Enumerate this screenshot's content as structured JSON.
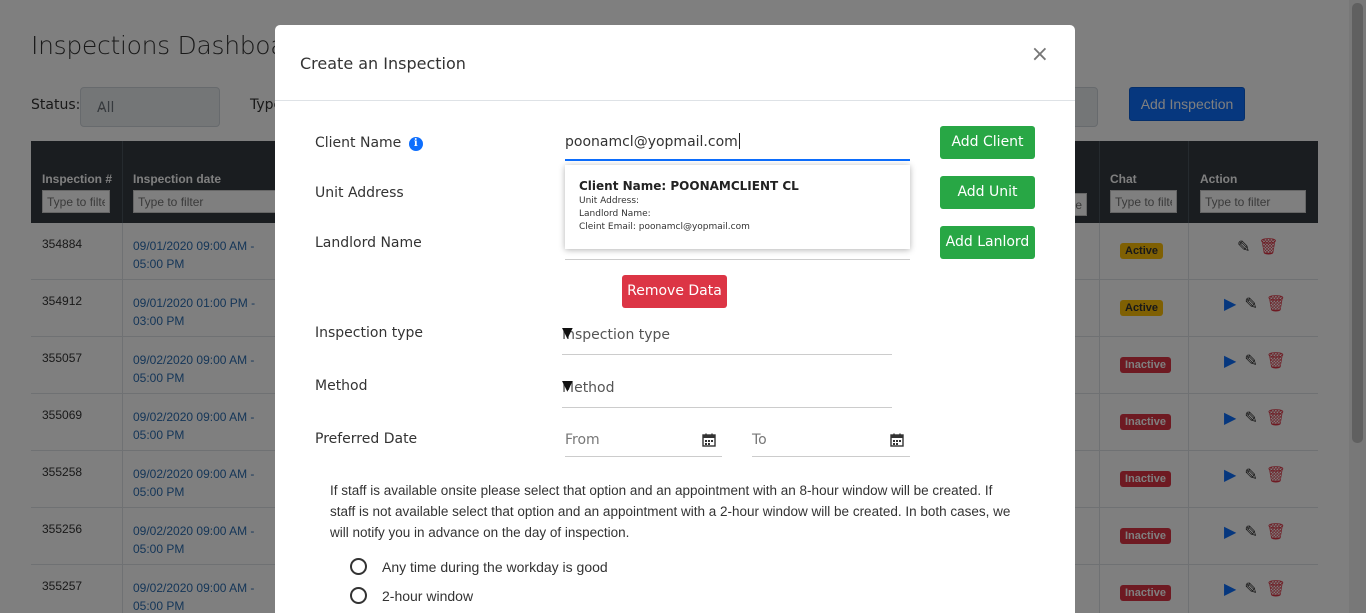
{
  "dashboard": {
    "title": "Inspections Dashboard",
    "status_label": "Status:",
    "status_value": "All",
    "type_label": "Type",
    "add_inspection": "Add Inspection"
  },
  "table": {
    "headers": {
      "inspection": "Inspection #",
      "date": "Inspection date",
      "chat": "Chat",
      "action": "Action"
    },
    "filter_placeholder": "Type to filter",
    "rows": [
      {
        "id": "354884",
        "date": "09/01/2020 09:00 AM - 05:00 PM",
        "status": "Active"
      },
      {
        "id": "354912",
        "date": "09/01/2020 01:00 PM - 03:00 PM",
        "status": "Active"
      },
      {
        "id": "355057",
        "date": "09/02/2020 09:00 AM - 05:00 PM",
        "status": "Inactive"
      },
      {
        "id": "355069",
        "date": "09/02/2020 09:00 AM - 05:00 PM",
        "status": "Inactive"
      },
      {
        "id": "355258",
        "date": "09/02/2020 09:00 AM - 05:00 PM",
        "status": "Inactive"
      },
      {
        "id": "355256",
        "date": "09/02/2020 09:00 AM - 05:00 PM",
        "status": "Inactive"
      },
      {
        "id": "355257",
        "date": "09/02/2020 09:00 AM - 05:00 PM",
        "status": "Inactive"
      }
    ]
  },
  "modal": {
    "title": "Create an Inspection",
    "close": "×",
    "client_label": "Client Name",
    "client_value": "poonamcl@yopmail.com",
    "unit_label": "Unit Address",
    "landlord_label": "Landlord Name",
    "add_client": "Add Client",
    "add_unit": "Add Unit",
    "add_landlord": "Add Lanlord",
    "suggestion": {
      "name": "Client Name: POONAMCLIENT CL",
      "unit": "Unit Address:",
      "landlord": "Landlord Name:",
      "email": "Cleint Email: poonamcl@yopmail.com"
    },
    "remove_data": "Remove Data",
    "type_label": "Inspection type",
    "type_placeholder": "Inspection type",
    "method_label": "Method",
    "method_placeholder": "Method",
    "date_label": "Preferred Date",
    "from_placeholder": "From",
    "to_placeholder": "To",
    "note": "If staff is available onsite please select that option and an appointment with an 8-hour window will be created. If staff is not available select that option and an appointment with a 2-hour window will be created. In both cases, we will notify you in advance on the day of inspection.",
    "option_1": "Any time during the workday is good",
    "option_2": "2-hour window"
  },
  "icons": {
    "info": "info-icon",
    "calendar": "calendar-icon",
    "dropdown": "triangle-down-icon"
  },
  "colors": {
    "primary": "#0d6efd",
    "success": "#28a745",
    "danger": "#dc3545",
    "warning": "#ffc107",
    "table_header": "#343a40"
  }
}
